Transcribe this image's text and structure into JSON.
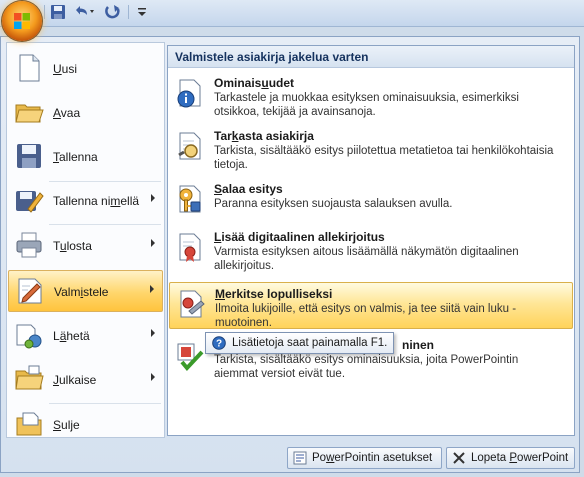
{
  "quick_access": {
    "save_icon": "save-icon",
    "undo_icon": "undo-icon",
    "redo_icon": "redo-icon",
    "customize_icon": "customize-arrow-icon"
  },
  "left_menu": {
    "items": [
      {
        "pre": "",
        "key": "U",
        "post": "usi",
        "icon": "new-document-icon",
        "has_submenu": false
      },
      {
        "pre": "",
        "key": "A",
        "post": "vaa",
        "icon": "open-folder-icon",
        "has_submenu": false
      },
      {
        "pre": "",
        "key": "T",
        "post": "allenna",
        "icon": "save-disk-icon",
        "has_submenu": false
      },
      {
        "pre": "Tallenna ni",
        "key": "m",
        "post": "ellä",
        "icon": "save-as-icon",
        "has_submenu": true
      },
      {
        "pre": "T",
        "key": "u",
        "post": "losta",
        "icon": "printer-icon",
        "has_submenu": true
      },
      {
        "pre": "Valm",
        "key": "i",
        "post": "stele",
        "icon": "prepare-icon",
        "has_submenu": true
      },
      {
        "pre": "L",
        "key": "ä",
        "post": "hetä",
        "icon": "send-icon",
        "has_submenu": true
      },
      {
        "pre": "",
        "key": "J",
        "post": "ulkaise",
        "icon": "publish-icon",
        "has_submenu": true
      },
      {
        "pre": "",
        "key": "S",
        "post": "ulje",
        "icon": "close-folder-icon",
        "has_submenu": false
      }
    ],
    "selected_index": 5
  },
  "right_panel": {
    "header": "Valmistele asiakirja jakelua varten",
    "items": [
      {
        "t_pre": "Ominais",
        "t_key": "u",
        "t_post": "udet",
        "desc": "Tarkastele ja muokkaa esityksen ominaisuuksia, esimerkiksi otsikkoa, tekijää ja avainsanoja.",
        "icon": "properties-icon"
      },
      {
        "t_pre": "Tar",
        "t_key": "k",
        "t_post": "asta asiakirja",
        "desc": "Tarkista, sisältääkö esitys piilotettua metatietoa tai henkilökohtaisia tietoja.",
        "icon": "inspect-document-icon"
      },
      {
        "t_pre": "",
        "t_key": "S",
        "t_post": "alaa esitys",
        "desc": "Paranna esityksen suojausta salauksen avulla.",
        "icon": "encrypt-key-icon"
      },
      {
        "t_pre": "",
        "t_key": "L",
        "t_post": "isää digitaalinen allekirjoitus",
        "desc": "Varmista esityksen aitous lisäämällä näkymätön digitaalinen allekirjoitus.",
        "icon": "digital-signature-icon"
      },
      {
        "t_pre": "",
        "t_key": "M",
        "t_post": "erkitse lopulliseksi",
        "desc": "Ilmoita lukijoille, että esitys on valmis, ja tee siitä vain luku -muotoinen.",
        "icon": "mark-final-icon"
      },
      {
        "t_pre": "",
        "t_key": "",
        "t_post": "ninen",
        "desc": "Tarkista, sisältääkö esitys ominaisuuksia, joita PowerPointin aiemmat versiot eivät tue.",
        "icon": "compatibility-check-icon"
      }
    ],
    "hover_index": 4
  },
  "tooltip": {
    "text": "Lisätietoja saat painamalla F1.",
    "icon": "help-icon"
  },
  "bottom_buttons": {
    "options": {
      "pre": "Po",
      "key": "w",
      "post": "erPointin asetukset",
      "icon": "options-icon"
    },
    "exit": {
      "pre": "Lopeta ",
      "key": "P",
      "post": "owerPoint",
      "icon": "close-x-icon"
    }
  },
  "colors": {
    "accent_orange": "#ffc43d",
    "frame_blue": "#8ba3c4",
    "header_text": "#15325e"
  }
}
